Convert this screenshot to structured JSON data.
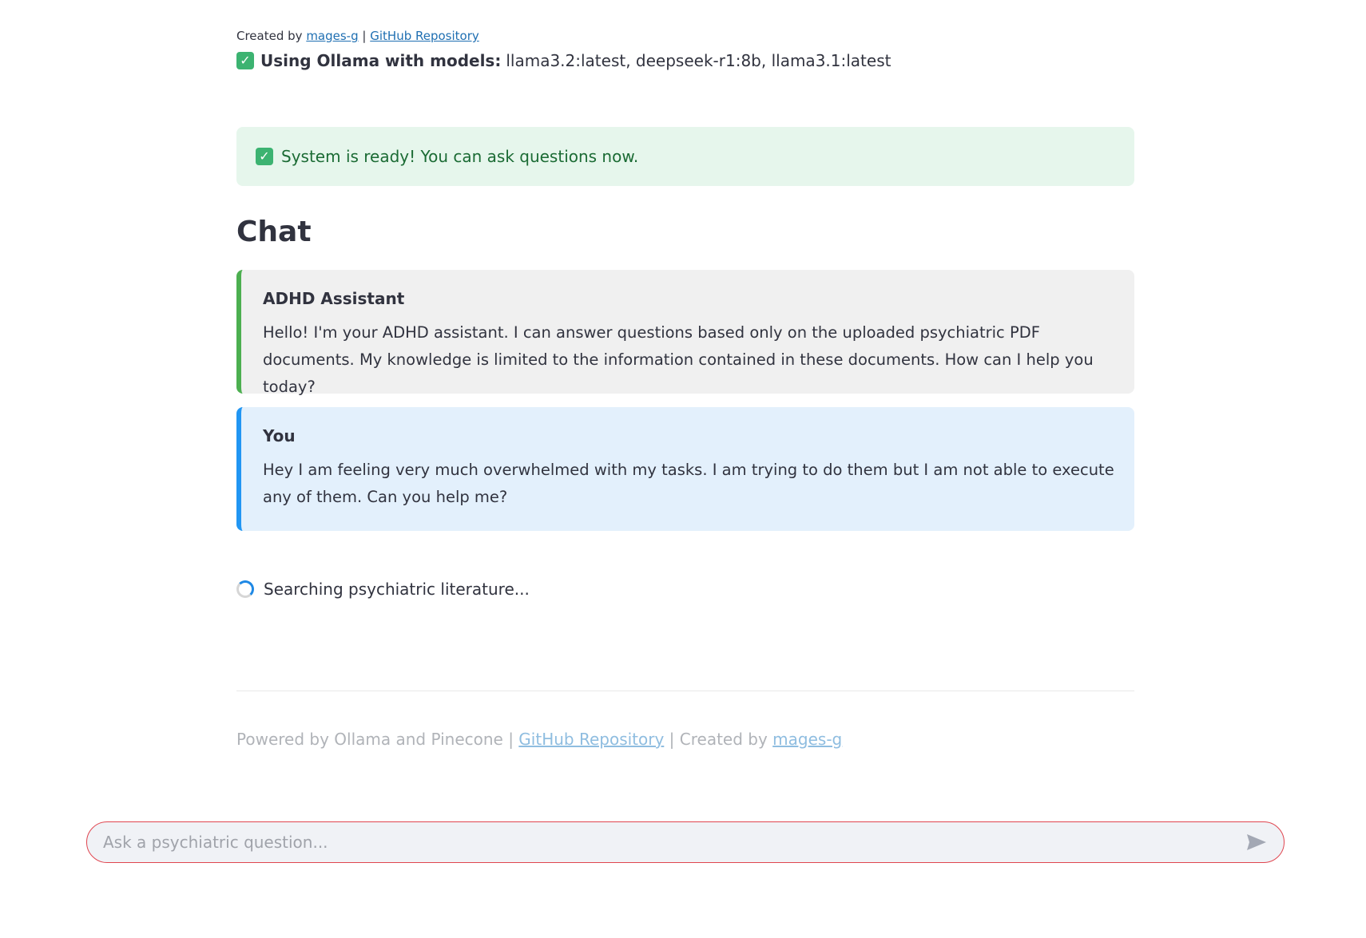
{
  "header": {
    "created_by_prefix": "Created by",
    "author_link": "mages-g",
    "separator": "|",
    "repo_link": "GitHub Repository",
    "models_label": "Using Ollama with models:",
    "models_value": "llama3.2:latest, deepseek-r1:8b, llama3.1:latest",
    "check_icon": "check-icon"
  },
  "status": {
    "success_text": "System is ready! You can ask questions now."
  },
  "chat": {
    "title": "Chat",
    "messages": [
      {
        "role": "assistant",
        "sender": "ADHD Assistant",
        "text": "Hello! I'm your ADHD assistant. I can answer questions based only on the uploaded psychiatric PDF documents. My knowledge is limited to the information contained in these documents. How can I help you today?"
      },
      {
        "role": "user",
        "sender": "You",
        "text": "Hey I am feeling very much overwhelmed with my tasks. I am trying to do them but I am not able to execute any of them. Can you help me?"
      }
    ],
    "loading_text": "Searching psychiatric literature..."
  },
  "footer": {
    "powered_text": "Powered by Ollama and Pinecone |",
    "repo_link": "GitHub Repository",
    "created_text": "| Created by",
    "author_link": "mages-g"
  },
  "input": {
    "placeholder": "Ask a psychiatric question...",
    "value": "",
    "send_icon": "send-icon"
  },
  "colors": {
    "assistant_accent": "#4caf50",
    "user_accent": "#2196f3",
    "input_border": "#e0454f",
    "link": "#1f6fb2"
  }
}
